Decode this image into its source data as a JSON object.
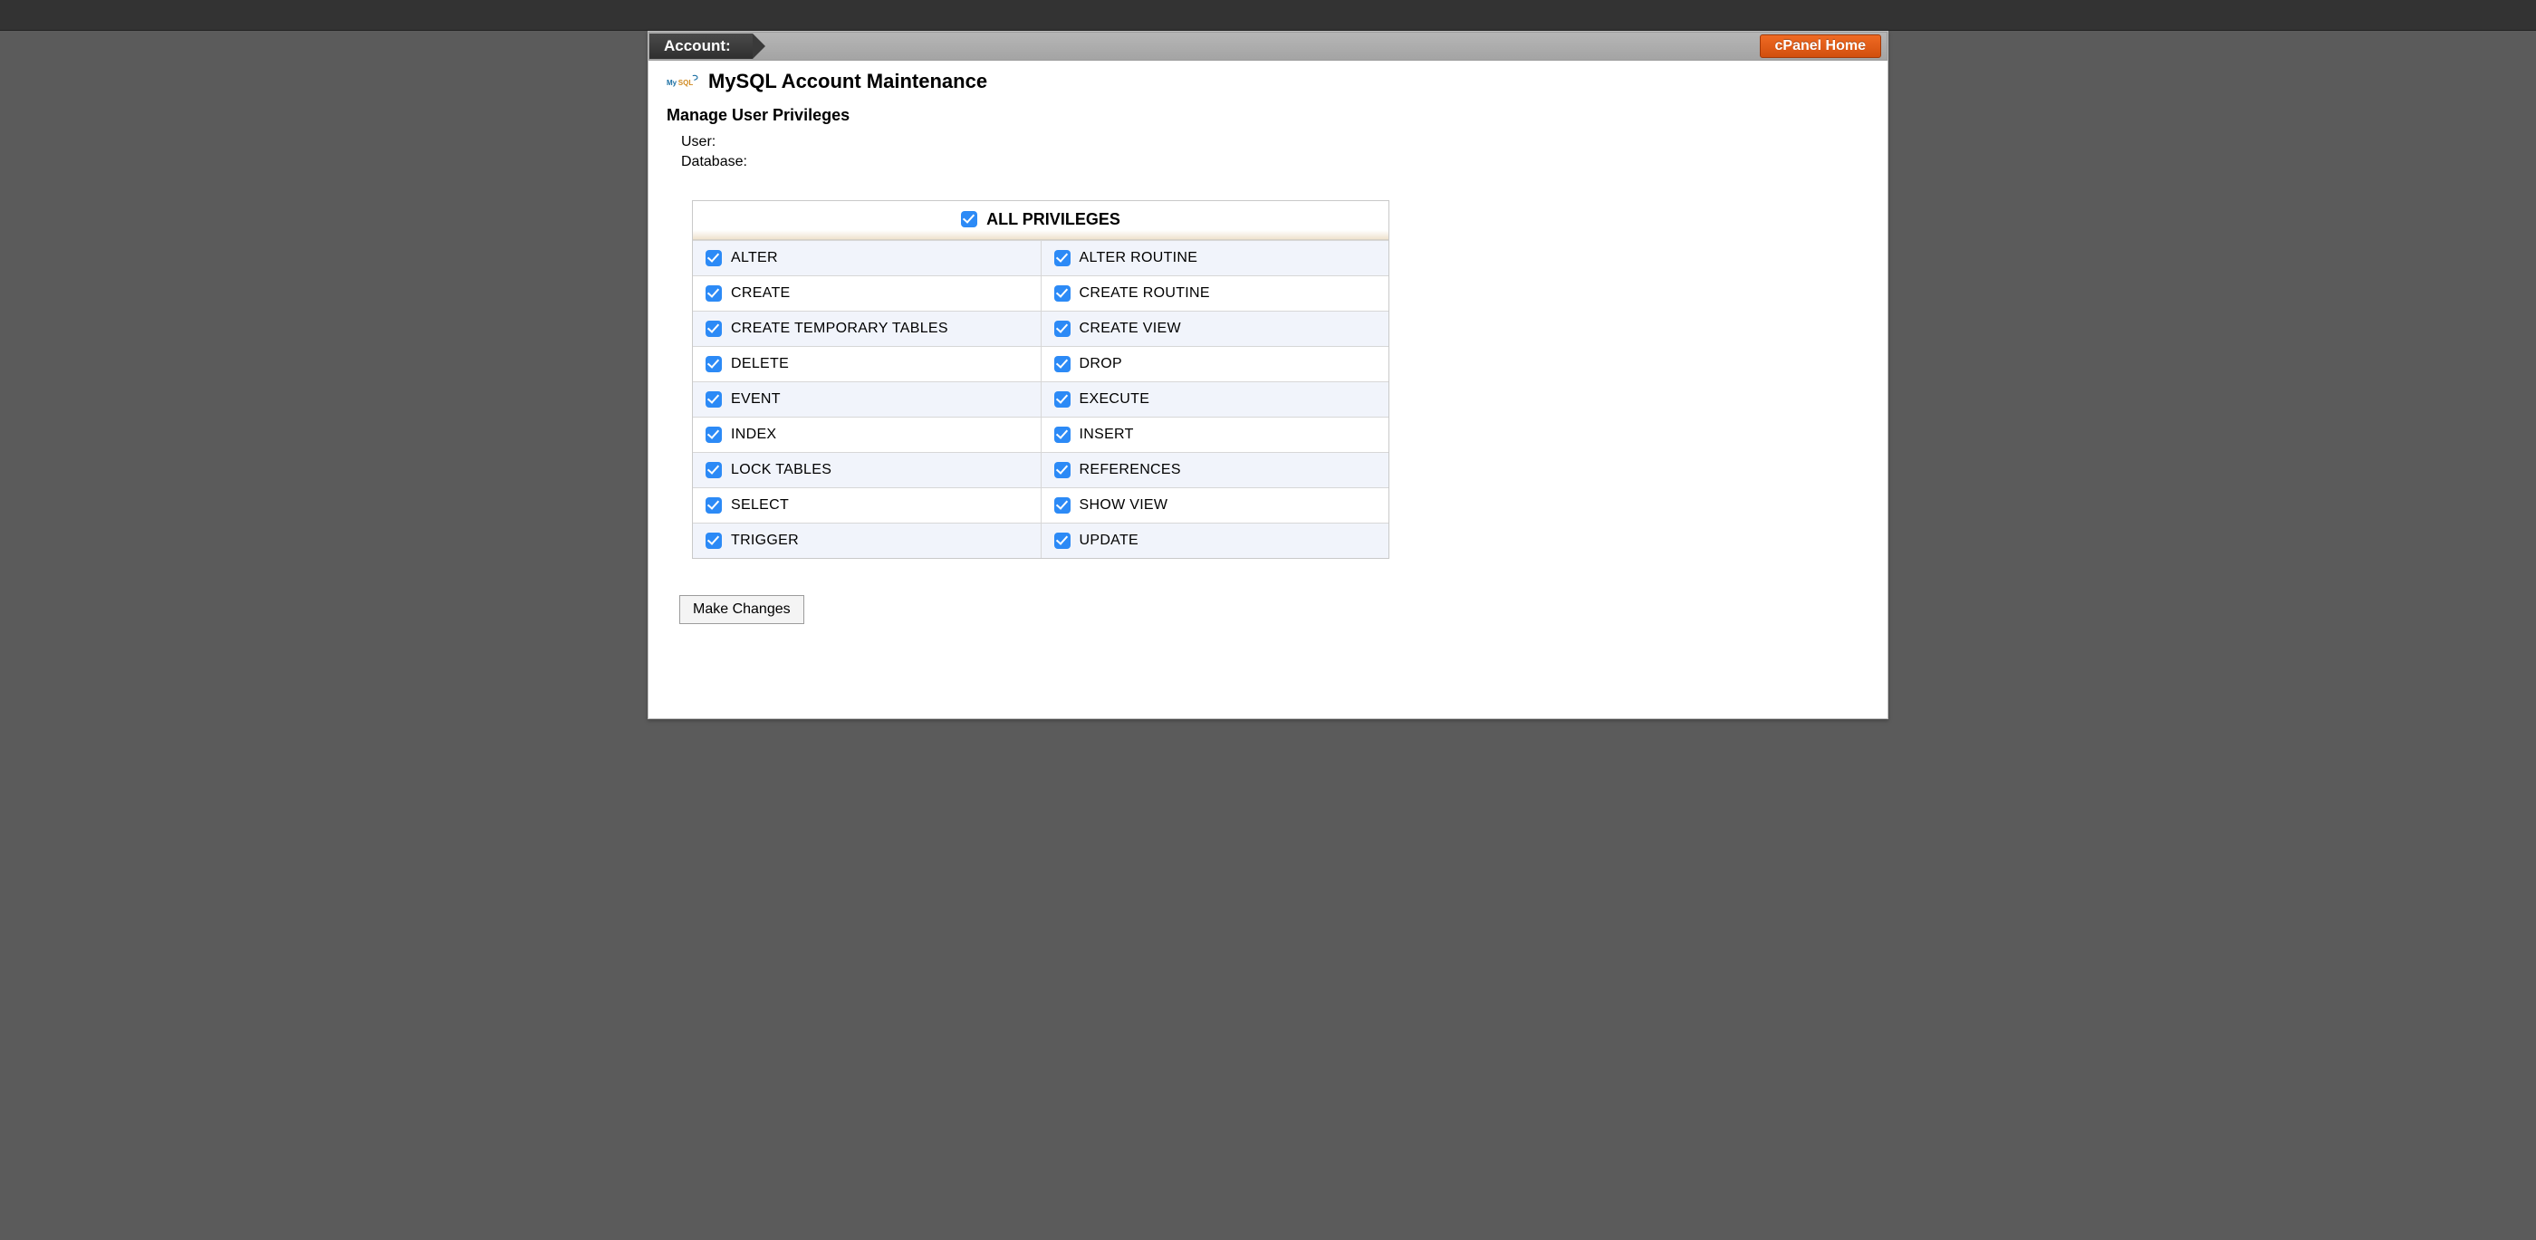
{
  "account_bar": {
    "label": "Account:",
    "cpanel_home": "cPanel Home"
  },
  "page": {
    "title": "MySQL Account Maintenance",
    "mysql_icon_name": "mysql-icon"
  },
  "section": {
    "heading": "Manage User Privileges",
    "user_label": "User:",
    "user_value": "",
    "database_label": "Database:",
    "database_value": ""
  },
  "privileges": {
    "all_label": "ALL PRIVILEGES",
    "all_checked": true,
    "rows": [
      {
        "left": "ALTER",
        "left_checked": true,
        "right": "ALTER ROUTINE",
        "right_checked": true
      },
      {
        "left": "CREATE",
        "left_checked": true,
        "right": "CREATE ROUTINE",
        "right_checked": true
      },
      {
        "left": "CREATE TEMPORARY TABLES",
        "left_checked": true,
        "right": "CREATE VIEW",
        "right_checked": true
      },
      {
        "left": "DELETE",
        "left_checked": true,
        "right": "DROP",
        "right_checked": true
      },
      {
        "left": "EVENT",
        "left_checked": true,
        "right": "EXECUTE",
        "right_checked": true
      },
      {
        "left": "INDEX",
        "left_checked": true,
        "right": "INSERT",
        "right_checked": true
      },
      {
        "left": "LOCK TABLES",
        "left_checked": true,
        "right": "REFERENCES",
        "right_checked": true
      },
      {
        "left": "SELECT",
        "left_checked": true,
        "right": "SHOW VIEW",
        "right_checked": true
      },
      {
        "left": "TRIGGER",
        "left_checked": true,
        "right": "UPDATE",
        "right_checked": true
      }
    ]
  },
  "buttons": {
    "make_changes": "Make Changes"
  }
}
